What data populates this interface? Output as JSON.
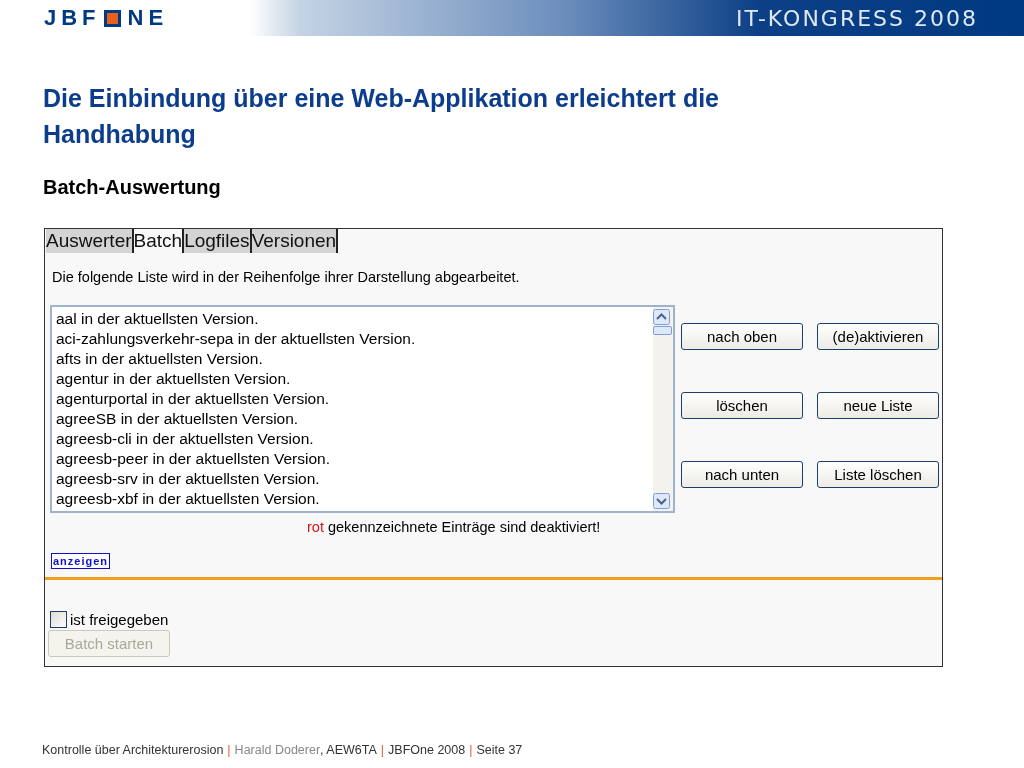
{
  "header": {
    "logo_before": "JBF",
    "logo_after": "NE",
    "event": "IT-KONGRESS 2008"
  },
  "title": "Die Einbindung über eine Web-Applikation erleichtert die Handhabung",
  "subtitle": "Batch-Auswertung",
  "app": {
    "tabs": [
      {
        "label": "Auswerter",
        "selected": false
      },
      {
        "label": "Batch",
        "selected": true
      },
      {
        "label": "Logfiles",
        "selected": false
      },
      {
        "label": "Versionen",
        "selected": false
      }
    ],
    "intro": "Die folgende Liste wird in der Reihenfolge ihrer Darstellung abgearbeitet.",
    "list_items": [
      "aal in der aktuellsten Version.",
      "aci-zahlungsverkehr-sepa in der aktuellsten Version.",
      "afts in der aktuellsten Version.",
      "agentur in der aktuellsten Version.",
      "agenturportal in der aktuellsten Version.",
      "agreeSB in der aktuellsten Version.",
      "agreesb-cli in der aktuellsten Version.",
      "agreesb-peer in der aktuellsten Version.",
      "agreesb-srv in der aktuellsten Version.",
      "agreesb-xbf in der aktuellsten Version."
    ],
    "buttons": [
      "nach oben",
      "(de)aktivieren",
      "löschen",
      "neue Liste",
      "nach unten",
      "Liste löschen"
    ],
    "legend": {
      "highlight": "rot",
      "text": "gekennzeichnete Einträge sind deaktiviert!"
    },
    "show_button": "anzeigen",
    "release_checkbox": {
      "label": "ist freigegeben",
      "checked": false
    },
    "start_button": {
      "label": "Batch starten",
      "disabled": true
    }
  },
  "footer": [
    {
      "text": "Kontrolle über Architekturerosion",
      "kind": "text"
    },
    {
      "text": "|",
      "kind": "separator"
    },
    {
      "text": "Harald Doderer",
      "kind": "muted"
    },
    {
      "text": ", AEW6TA",
      "kind": "text"
    },
    {
      "text": "|",
      "kind": "separator"
    },
    {
      "text": "JBFOne 2008",
      "kind": "text"
    },
    {
      "text": "|",
      "kind": "separator"
    },
    {
      "text": "Seite 37",
      "kind": "text"
    }
  ]
}
